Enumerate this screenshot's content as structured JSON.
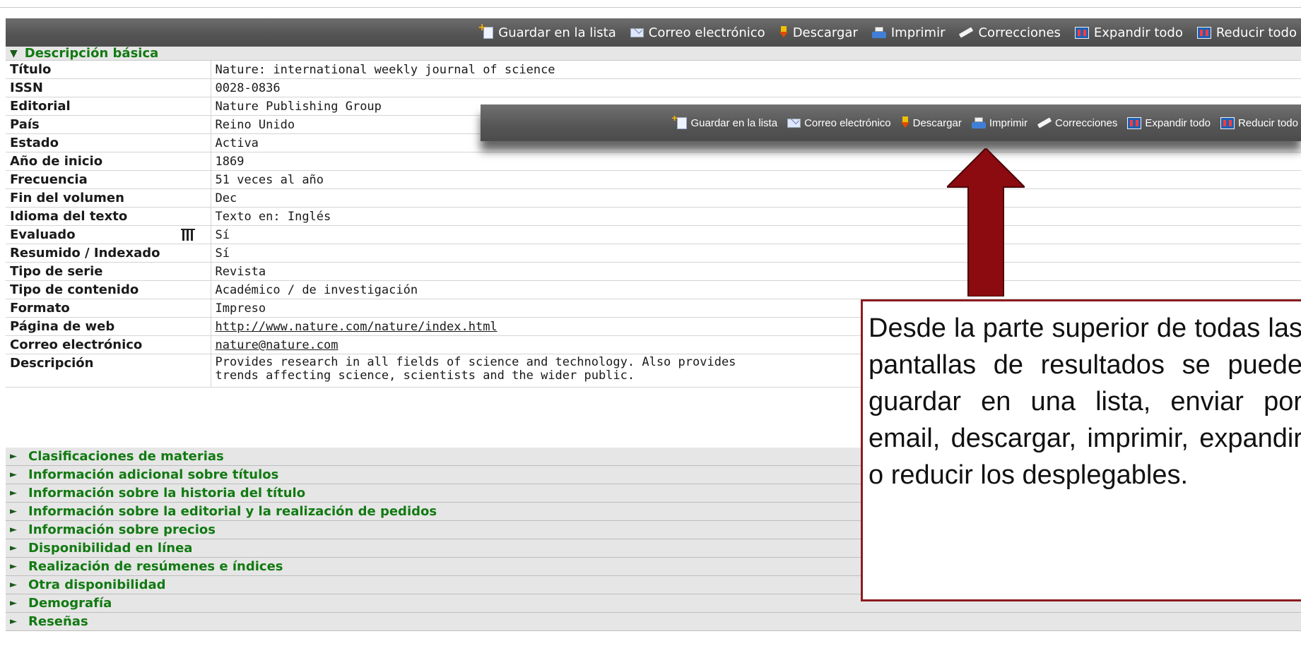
{
  "toolbar": {
    "save": "Guardar en la lista",
    "email": "Correo electrónico",
    "download": "Descargar",
    "print": "Imprimir",
    "corrections": "Correcciones",
    "expand": "Expandir todo",
    "collapse": "Reducir todo"
  },
  "section_title": "Descripción básica",
  "rows": [
    {
      "label": "Título",
      "value": "Nature: international weekly journal of science"
    },
    {
      "label": "ISSN",
      "value": "0028-0836"
    },
    {
      "label": "Editorial",
      "value": "Nature Publishing Group"
    },
    {
      "label": "País",
      "value": "Reino Unido"
    },
    {
      "label": "Estado",
      "value": "Activa"
    },
    {
      "label": "Año de inicio",
      "value": "1869"
    },
    {
      "label": "Frecuencia",
      "value": "51 veces al año"
    },
    {
      "label": "Fin del volumen",
      "value": "Dec"
    },
    {
      "label": "Idioma del texto",
      "value": "Texto en: Inglés"
    },
    {
      "label": "Evaluado",
      "value": "Sí"
    },
    {
      "label": "Resumido / Indexado",
      "value": "Sí"
    },
    {
      "label": "Tipo de serie",
      "value": "Revista"
    },
    {
      "label": "Tipo de contenido",
      "value": "Académico / de investigación"
    },
    {
      "label": "Formato",
      "value": "Impreso"
    },
    {
      "label": "Página de web",
      "value": "http://www.nature.com/nature/index.html"
    },
    {
      "label": "Correo electrónico",
      "value": "nature@nature.com"
    },
    {
      "label": "Descripción",
      "value": "Provides research in all fields of science and technology. Also provides",
      "value2": "trends affecting science, scientists and the wider public."
    }
  ],
  "collapsed_sections": [
    "Clasificaciones de materias",
    "Información adicional sobre títulos",
    "Información sobre la historia del título",
    "Información sobre la editorial y la realización de pedidos",
    "Información sobre precios",
    "Disponibilidad en línea",
    "Realización de resúmenes e índices",
    "Otra disponibilidad",
    "Demografía",
    "Reseñas"
  ],
  "callout_text": "Desde la parte superior de todas las pantallas de resultados se puede guardar en una lista, enviar por email, descargar, imprimir, expandir o reducir los desplegables.",
  "colors": {
    "toolbar": "#555555",
    "section_text": "#127a12",
    "callout_border": "#8c1b21",
    "arrow": "#8b0b10"
  }
}
